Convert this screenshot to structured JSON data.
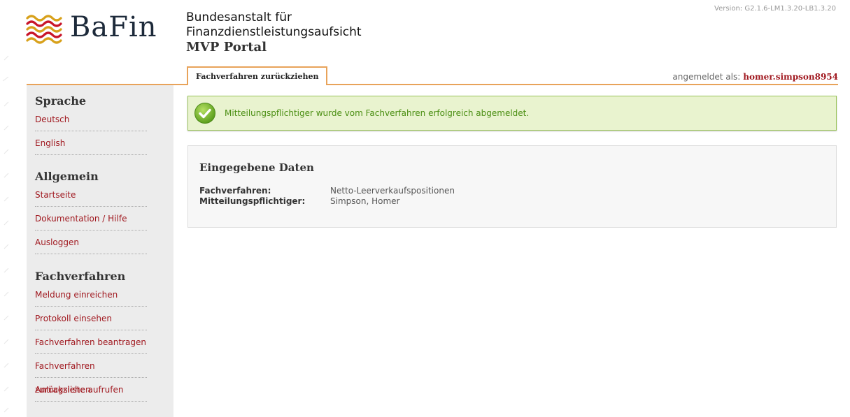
{
  "header": {
    "logo_text": "BaFin",
    "org_line1": "Bundesanstalt für",
    "org_line2": "Finanzdienstleistungsaufsicht",
    "portal": "MVP Portal",
    "version": "Version: G2.1.6-LM1.3.20-LB1.3.20"
  },
  "tabs": [
    {
      "label": "Fachverfahren zurückziehen",
      "active": true
    }
  ],
  "login": {
    "label": "angemeldet als:",
    "user": "homer.simpson8954"
  },
  "sidebar": {
    "sections": [
      {
        "title": "Sprache",
        "items": [
          "Deutsch",
          "English"
        ]
      },
      {
        "title": "Allgemein",
        "items": [
          "Startseite",
          "Dokumentation / Hilfe",
          "Ausloggen"
        ]
      },
      {
        "title": "Fachverfahren",
        "items": [
          "Meldung einreichen",
          "Protokoll einsehen",
          "Fachverfahren beantragen",
          "Fachverfahren zurückziehen",
          "Antragsliste aufrufen"
        ]
      }
    ]
  },
  "message": {
    "text": "Mitteilungspflichtiger wurde vom Fachverfahren erfolgreich abgemeldet.",
    "icon": "check-circle-icon"
  },
  "data_panel": {
    "title": "Eingegebene Daten",
    "rows": [
      {
        "label": "Fachverfahren:",
        "value": "Netto-Leerverkaufspositionen"
      },
      {
        "label": "Mitteilungspflichtiger:",
        "value": "Simpson, Homer"
      }
    ]
  },
  "colors": {
    "accent": "#e8a35a",
    "link": "#a0181f",
    "success_bg": "#e9f3cf",
    "success_border": "#9bc45c",
    "success_text": "#4a8e12",
    "sidebar_bg": "#ececec"
  }
}
